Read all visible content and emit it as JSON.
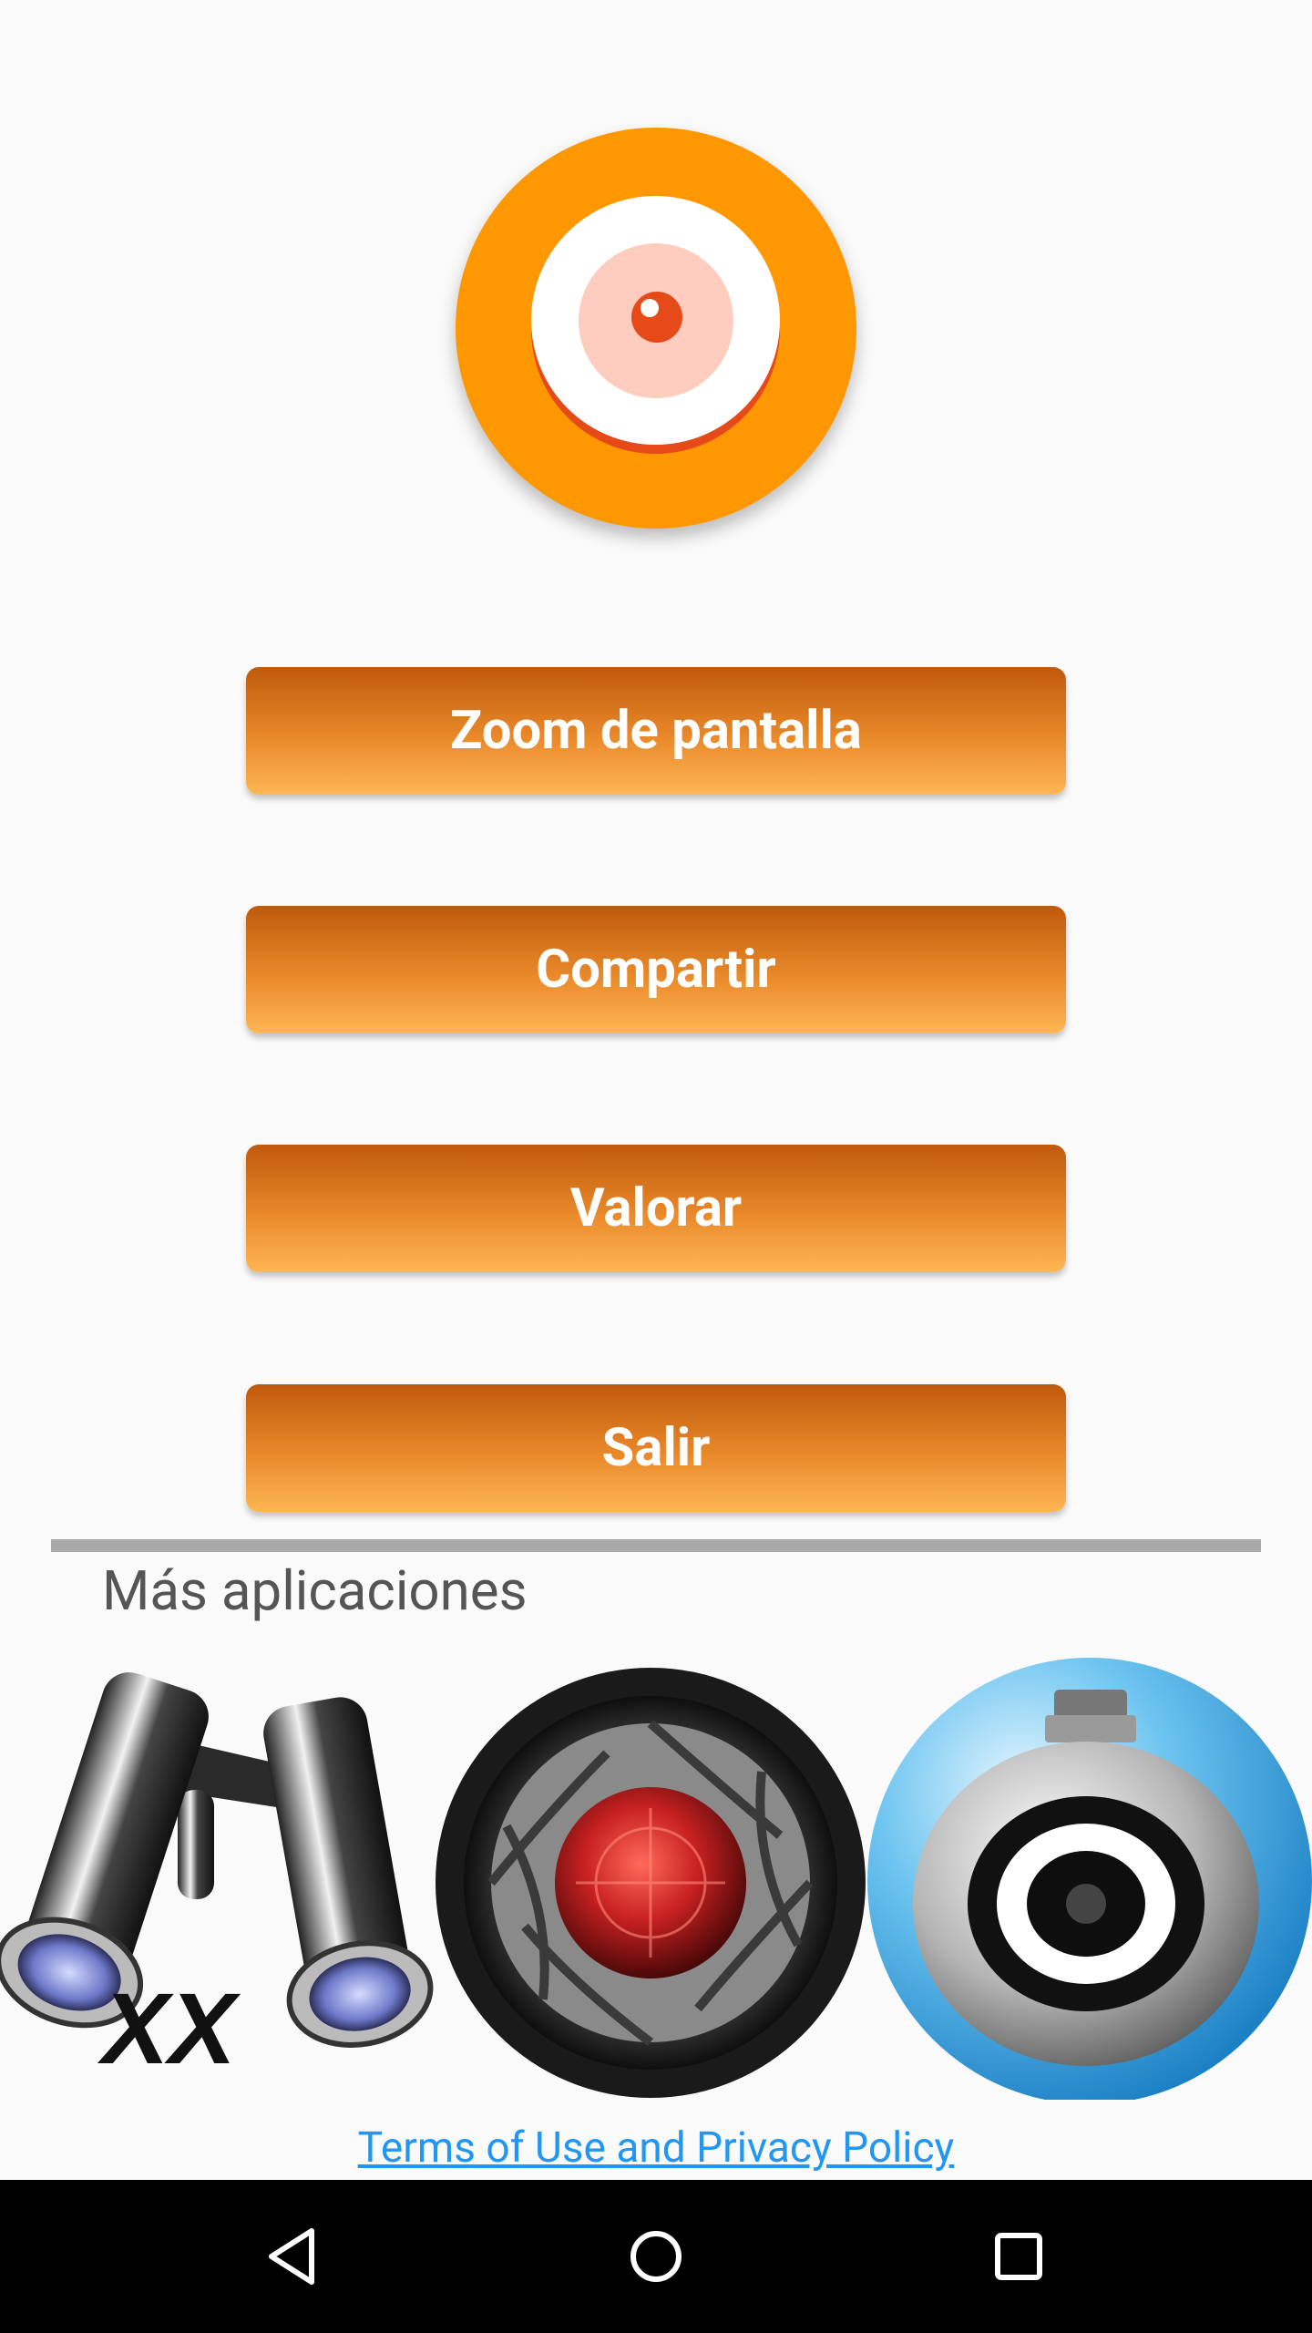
{
  "buttons": {
    "zoom": "Zoom de pantalla",
    "share": "Compartir",
    "rate": "Valorar",
    "exit": "Salir"
  },
  "more_apps": {
    "title": "Más aplicaciones",
    "apps": [
      {
        "icon": "binoculars-icon",
        "caption": "XX"
      },
      {
        "icon": "camera-lens-icon"
      },
      {
        "icon": "webcam-icon"
      }
    ]
  },
  "footer": {
    "terms_link": "Terms of Use and Privacy Policy"
  },
  "nav": {
    "back": "back-icon",
    "home": "home-icon",
    "recents": "recents-icon"
  },
  "colors": {
    "accent_orange": "#ff9800",
    "eye_red": "#e64a19",
    "button_gradient_top": "#bf5a0c",
    "button_gradient_bottom": "#ffb653",
    "link_blue": "#2196f3"
  }
}
